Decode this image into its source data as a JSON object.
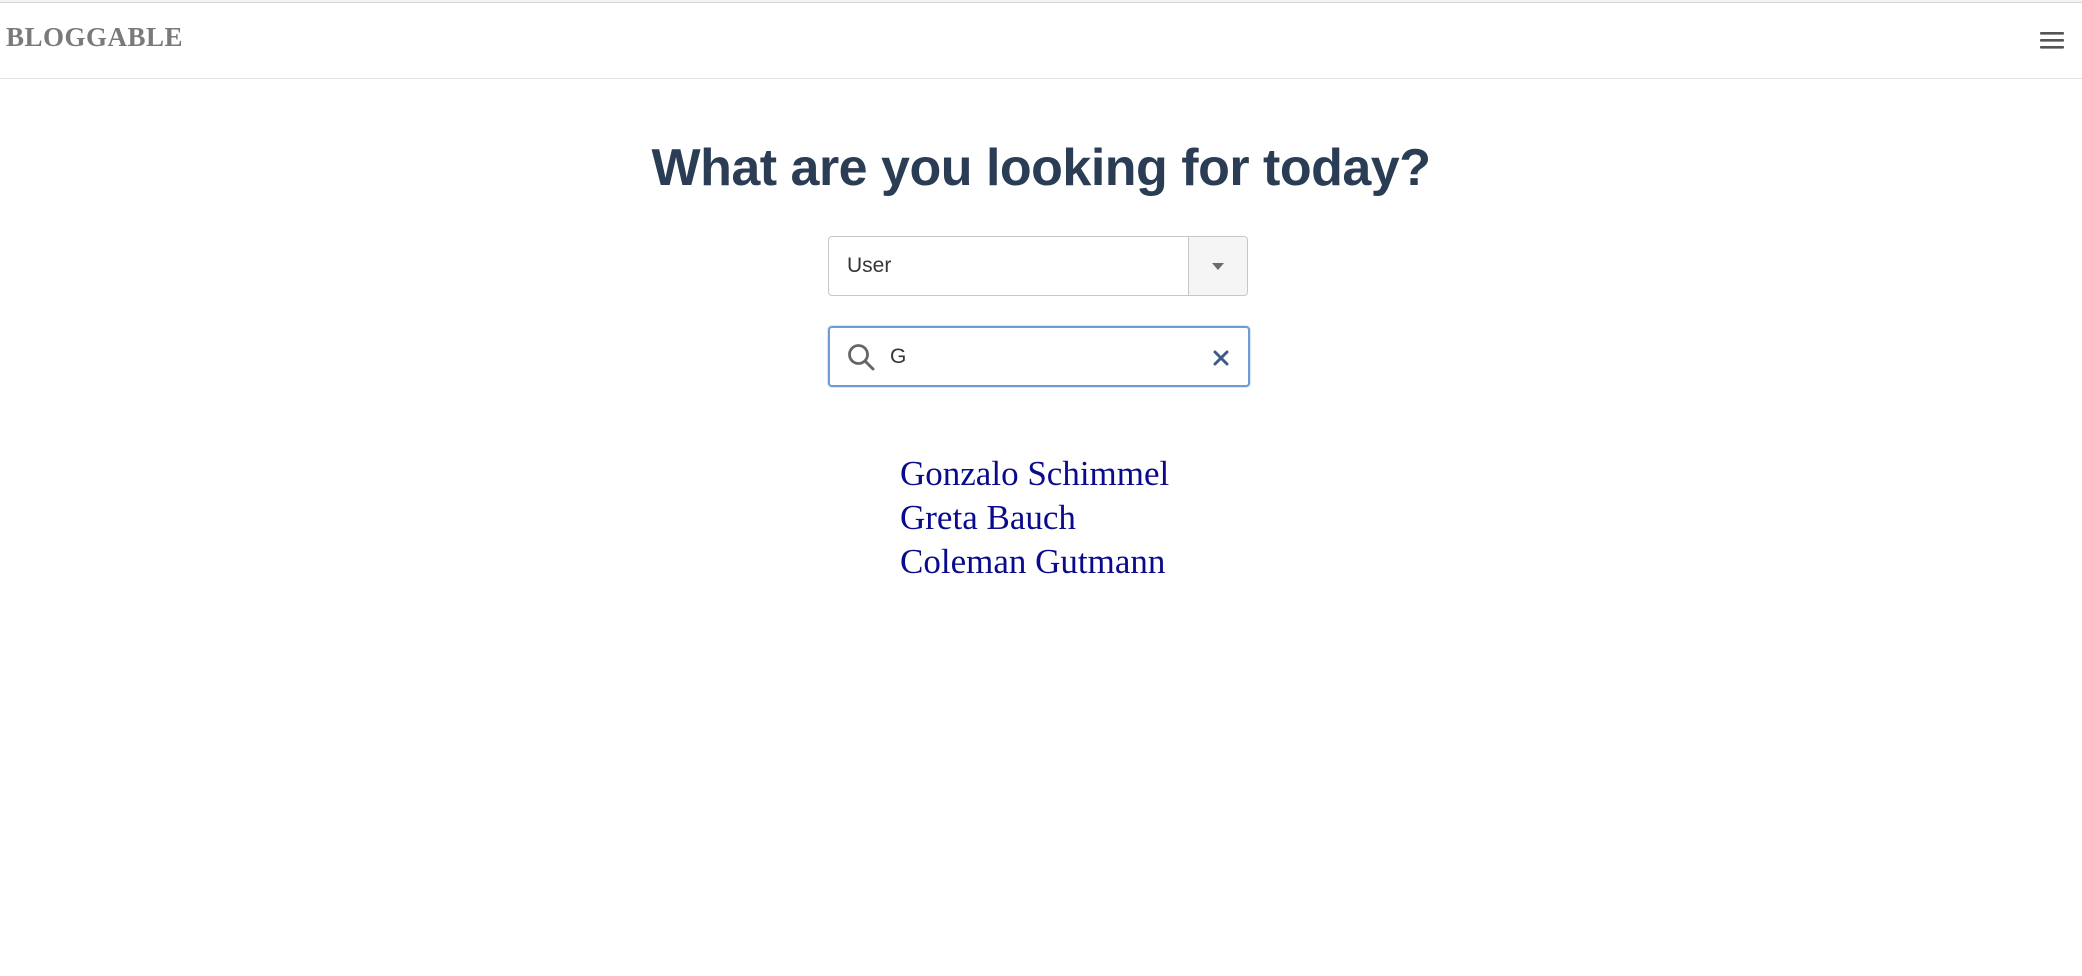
{
  "navbar": {
    "brand": "BLOGGABLE",
    "menu_icon": "hamburger-menu-icon"
  },
  "hero": {
    "title": "What are you looking for today?"
  },
  "search_type_select": {
    "selected": "User",
    "arrow_icon": "caret-down-icon"
  },
  "search": {
    "value": "G",
    "search_icon": "magnifier-icon",
    "clear_icon": "close-x-icon"
  },
  "results": [
    "Gonzalo Schimmel",
    "Greta Bauch",
    "Coleman Gutmann"
  ],
  "colors": {
    "heading": "#2b3d55",
    "link": "#0a0a8c",
    "focus_border": "#6f9bd6",
    "brand": "#7a7a7a"
  }
}
